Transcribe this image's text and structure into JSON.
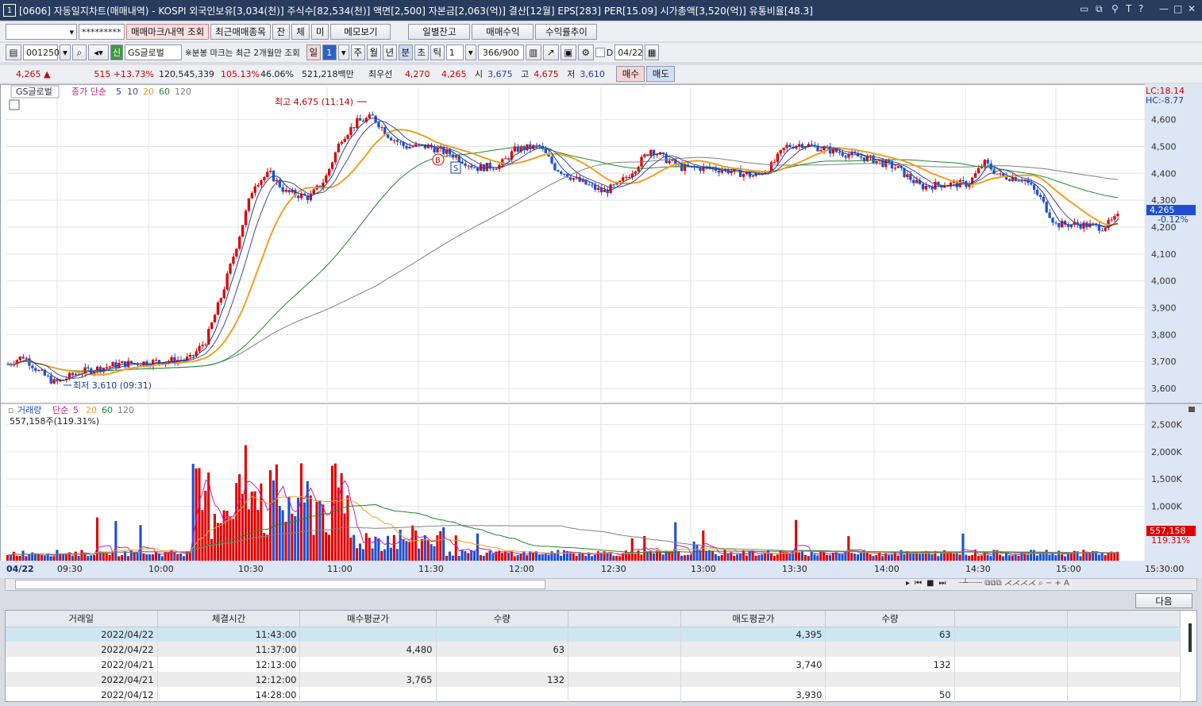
{
  "titlebar": {
    "num": "1",
    "text": "[0606] 자동일지차트(매매내역) - KOSPI 외국인보유[3,034(천)] 주식수[82,534(천)] 액면[2,500] 자본금[2,063(억)] 결산[12월] EPS[283] PER[15.09] 시가총액[3,520(억)] 유통비율[48.3]"
  },
  "toolbar1": {
    "password": "*********",
    "btn_mark": "매매마크/내역 조회",
    "btn_recent": "최근매매종목",
    "btn_jan": "잔",
    "btn_che": "체",
    "btn_mi": "미",
    "btn_memo": "메모보기",
    "btn_daily": "일별잔고",
    "btn_profit": "매매수익",
    "btn_trend": "수익률추이"
  },
  "toolbar2": {
    "code": "001250",
    "sin": "신",
    "name": "GS글로벌",
    "note": "※분봉 마크는 최근 2개월만 조회",
    "day": "일",
    "n1": "1",
    "week": "주",
    "month": "월",
    "year": "년",
    "min": "분",
    "sec": "초",
    "tick": "틱",
    "n2": "1",
    "count": "366/900",
    "d": "D",
    "date": "04/22"
  },
  "quote": {
    "price": "4,265 ▲",
    "change": "515 +13.73%",
    "volume": "120,545,339",
    "vr": "105.13%",
    "ratio": "46.06%",
    "amount": "521,218백만",
    "best_label": "최우선",
    "ask": "4,270",
    "bid": "4,265",
    "open_l": "시",
    "open": "3,675",
    "high_l": "고",
    "high": "4,675",
    "low_l": "저",
    "low": "3,610",
    "buy": "매수",
    "sell": "매도"
  },
  "chart": {
    "stock": "GS글로벌",
    "ma_label": "종가 단순",
    "ma": [
      "5",
      "10",
      "20",
      "60",
      "120"
    ],
    "high_label": "최고 4,675 (11:14)",
    "low_label": "최저 3,610 (09:31)",
    "lc": "LC:18.14",
    "hc": "HC:-8.77",
    "cur": "4,265",
    "cur_pct": "-0.12%",
    "yticks": [
      "4,600",
      "4,500",
      "4,400",
      "4,300",
      "4,200",
      "4,100",
      "4,000",
      "3,900",
      "3,800",
      "3,700",
      "3,600"
    ],
    "vol_label": "거래량",
    "vol_ma_label": "단순",
    "vol_info": "557,158주(119.31%)",
    "vticks": [
      "2,500K",
      "2,000K",
      "1,500K",
      "1,000K"
    ],
    "vol_cur": "557,158",
    "vol_pct": "119.31%",
    "xticks": [
      "04/22",
      "09:30",
      "10:00",
      "10:30",
      "11:00",
      "11:30",
      "12:00",
      "12:30",
      "13:00",
      "13:30",
      "14:00",
      "14:30",
      "15:00",
      "15:30:00"
    ],
    "mark_b": "B",
    "mark_s": "S"
  },
  "table": {
    "next": "다음",
    "headers": [
      "거래일",
      "체결시간",
      "매수평균가",
      "수량",
      "",
      "매도평균가",
      "수량",
      "",
      ""
    ],
    "rows": [
      [
        "2022/04/22",
        "11:43:00",
        "",
        "",
        "",
        "4,395",
        "63",
        "",
        ""
      ],
      [
        "2022/04/22",
        "11:37:00",
        "4,480",
        "63",
        "",
        "",
        "",
        "",
        ""
      ],
      [
        "2022/04/21",
        "12:13:00",
        "",
        "",
        "",
        "3,740",
        "132",
        "",
        ""
      ],
      [
        "2022/04/21",
        "12:12:00",
        "3,765",
        "132",
        "",
        "",
        "",
        "",
        ""
      ],
      [
        "2022/04/12",
        "14:28:00",
        "",
        "",
        "",
        "3,930",
        "50",
        "",
        ""
      ]
    ]
  },
  "colors": {
    "up": "#e00000",
    "down": "#1e4fd0",
    "ma5": "#1a3fa0",
    "ma20": "#f0a020",
    "ma60": "#1f8a2e",
    "ma120": "#808080"
  }
}
